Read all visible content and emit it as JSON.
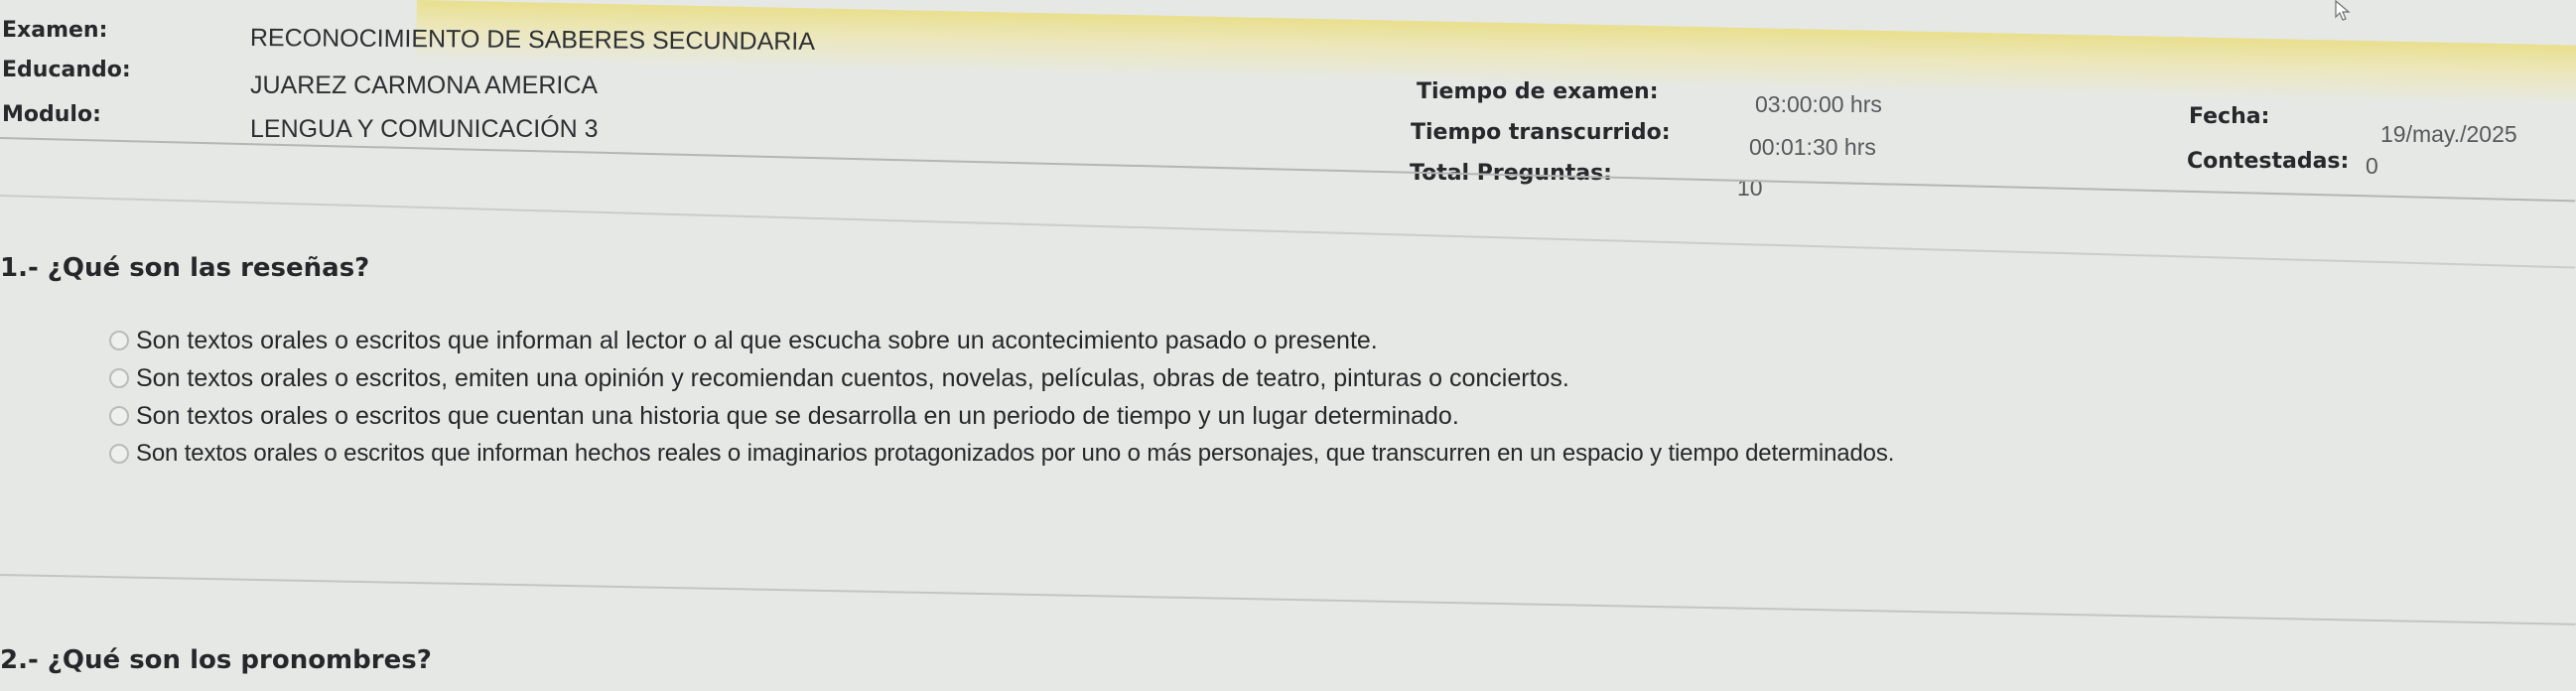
{
  "header": {
    "left": [
      {
        "label": "Examen:",
        "value": "RECONOCIMIENTO DE SABERES SECUNDARIA"
      },
      {
        "label": "Educando:",
        "value": "JUAREZ CARMONA AMERICA"
      },
      {
        "label": "Modulo:",
        "value": "LENGUA Y COMUNICACIÓN 3"
      }
    ],
    "middle": [
      {
        "label": "Tiempo de examen:",
        "value": "03:00:00 hrs"
      },
      {
        "label": "Tiempo transcurrido:",
        "value": "00:01:30 hrs"
      },
      {
        "label": "Total Preguntas:",
        "value": "10"
      }
    ],
    "right": {
      "fecha_label": "Fecha:",
      "fecha_value": "19/may./2025",
      "contestadas_label": "Contestadas:",
      "contestadas_value": "0"
    }
  },
  "questions": [
    {
      "text": "1.- ¿Qué son las reseñas?",
      "options": [
        "Son textos orales o escritos que informan al lector o al que escucha sobre un acontecimiento pasado o presente.",
        "Son textos orales o escritos, emiten una opinión y recomiendan cuentos, novelas, películas, obras de teatro, pinturas o conciertos.",
        "Son textos orales o escritos que cuentan una historia que se desarrolla en un periodo de tiempo y un lugar determinado.",
        "Son textos orales o escritos que informan hechos reales o imaginarios protagonizados por uno o más personajes, que transcurren en un espacio y tiempo determinados."
      ]
    },
    {
      "text": "2.- ¿Qué son los pronombres?",
      "options": []
    }
  ],
  "icons": {
    "cursor": "mouse-pointer-icon",
    "option_marker": "radio-button"
  },
  "colors": {
    "background": "#e6e8e5",
    "text": "#1e2021",
    "rule": "#b3b6b5",
    "highlight": "#e9df8e"
  }
}
